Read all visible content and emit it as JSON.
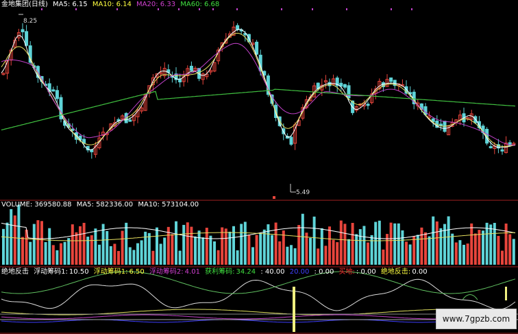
{
  "main_header": {
    "title": "金地集团(日线)",
    "ma5": "MA5: 6.15",
    "ma10": "MA10: 6.14",
    "ma20": "MA20: 6.33",
    "ma60": "MA60: 6.68"
  },
  "price_labels": {
    "high": "8.25",
    "low": "5.49"
  },
  "volume_header": {
    "volume": "VOLUME: 369580.88",
    "ma5": "MA5: 582336.00",
    "ma10": "MA10: 573104.00"
  },
  "indicator_header": {
    "name": "绝地反击",
    "float_chips1_label": "浮动筹码1:",
    "float_chips1_value": "10.50",
    "float_chips2_label": "浮动筹码1:",
    "float_chips2_value": "6.50",
    "float_chips3_label": "浮动筹码2:",
    "float_chips3_value": "4.01",
    "profit_chips_label": "获利筹码:",
    "profit_chips_value": "34.24",
    "v1": ": 40.00",
    "v2": "20.00",
    "v3": ": 0.00",
    "bottom_label": "买地:",
    "bottom_value": ": 0.00",
    "counter_label": "绝地反击:",
    "counter_value": "0.00"
  },
  "watermark": "www.7gpzb.com",
  "colors": {
    "up": "#e8453c",
    "down": "#5fd4d8",
    "ma5": "#ffffff",
    "ma10": "#e8e060",
    "ma20": "#c040c8",
    "ma60": "#40c040",
    "axis": "#a02020",
    "header_white": "#ffffff",
    "header_yellow": "#ffff40",
    "header_purple": "#d040d0",
    "header_green": "#40e040",
    "header_blue": "#4040ff",
    "header_red": "#ff3030"
  }
}
